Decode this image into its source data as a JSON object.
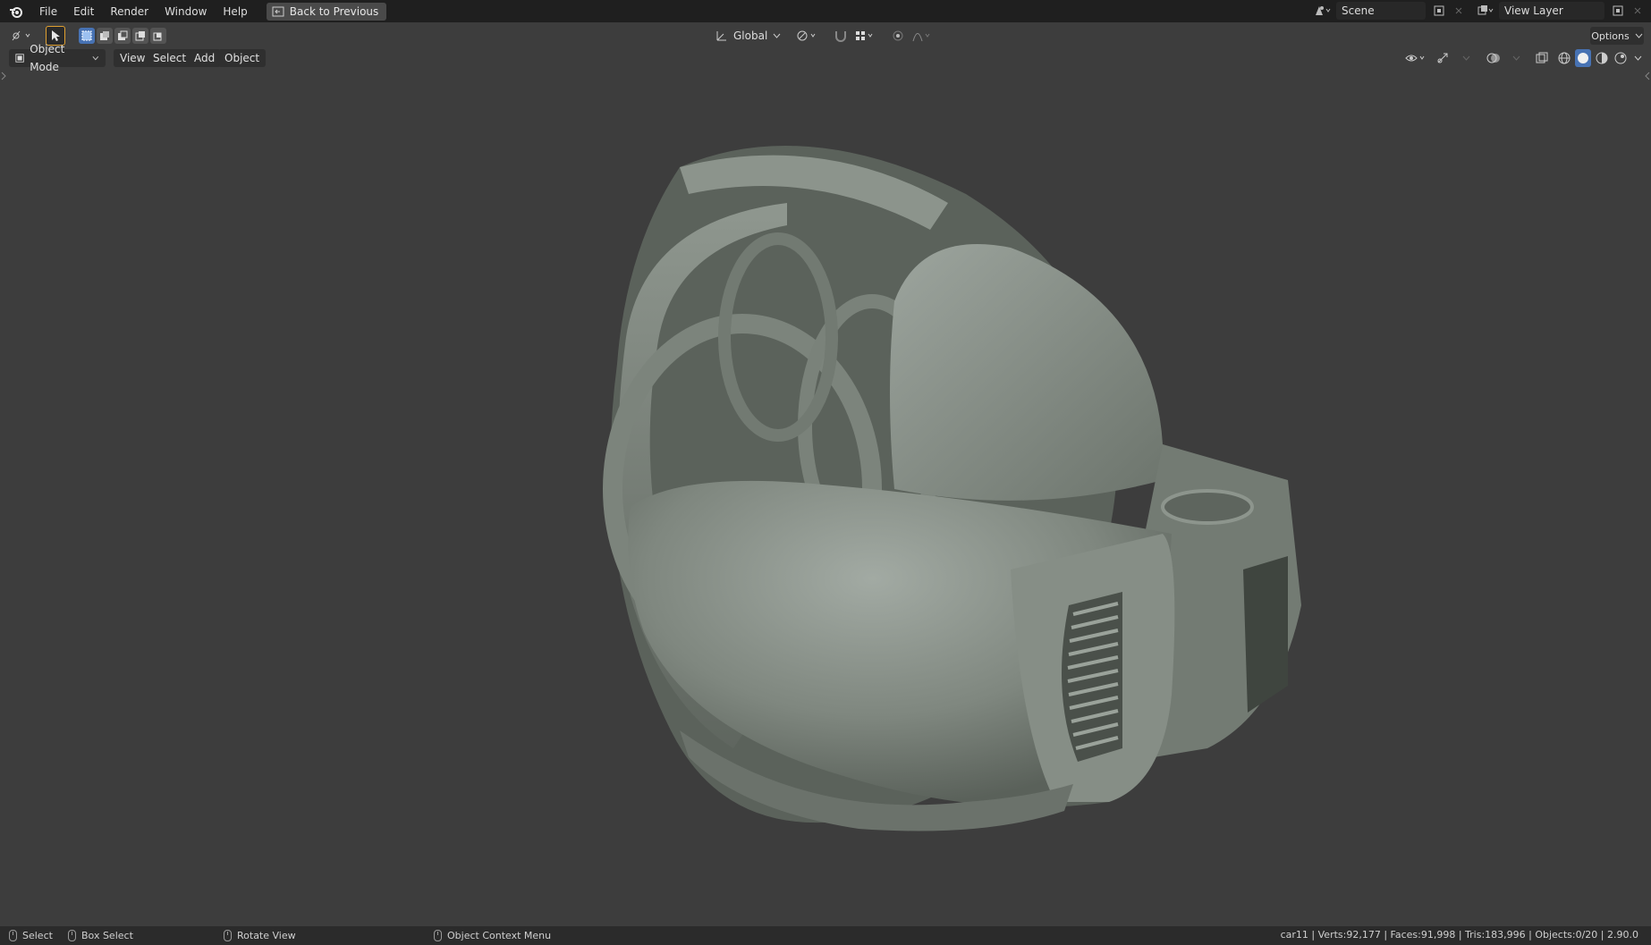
{
  "menubar": {
    "items": [
      "File",
      "Edit",
      "Render",
      "Window",
      "Help"
    ],
    "back_button": "Back to Previous",
    "scene": "Scene",
    "view_layer": "View Layer"
  },
  "toolbar": {
    "transform_orientation": "Global",
    "options": "Options"
  },
  "header": {
    "mode": "Object Mode",
    "menus": [
      "View",
      "Select",
      "Add",
      "Object"
    ]
  },
  "statusbar": {
    "select": "Select",
    "box_select": "Box Select",
    "rotate_view": "Rotate View",
    "context_menu": "Object Context Menu",
    "stats": "car11 | Verts:92,177 | Faces:91,998 | Tris:183,996 | Objects:0/20 | 2.90.0"
  },
  "colors": {
    "viewport_bg": "#3d3d3d",
    "topbar_bg": "#1f1f1f",
    "model": "#8d948d"
  }
}
